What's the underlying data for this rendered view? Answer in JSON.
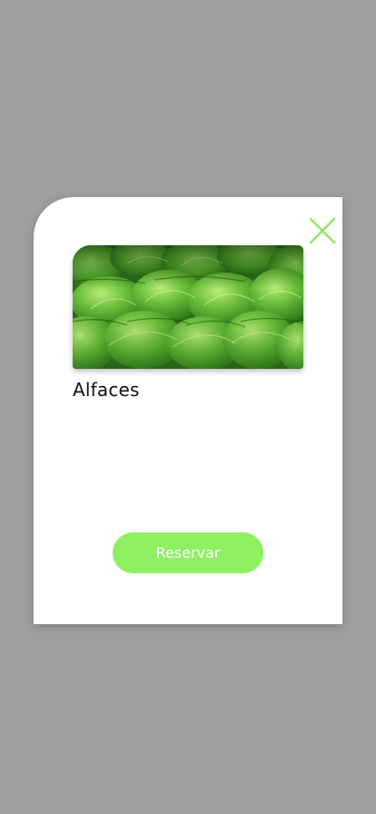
{
  "product": {
    "name": "Alfaces",
    "image_icon": "lettuce-photo"
  },
  "actions": {
    "reserve_label": "Reservar",
    "close_icon": "close-icon"
  },
  "colors": {
    "accent": "#8ff062",
    "close_icon": "#8fe86a",
    "backdrop": "#9e9e9e",
    "card": "#ffffff"
  }
}
